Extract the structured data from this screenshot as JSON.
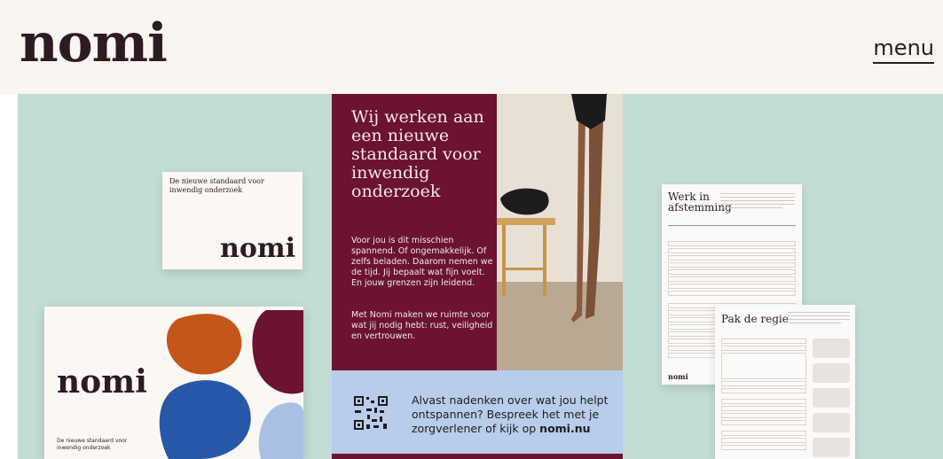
{
  "header": {
    "logo": "nomi",
    "menu_label": "menu"
  },
  "card_small": {
    "subtitle": "De nieuwe standaard voor inwendig onderzoek",
    "brand": "nomi"
  },
  "box": {
    "brand": "nomi",
    "subtitle": "De nieuwe standaard voor inwendig onderzoek"
  },
  "poster": {
    "headline": "Wij werken aan een nieuwe standaard voor inwendig onderzoek",
    "body1": "Voor jou is dit misschien spannend. Of ongemakkelijk. Of zelfs beladen. Daarom nemen we de tijd. Jij bepaalt wat fijn voelt. En jouw grenzen zijn leidend.",
    "body2": "Met Nomi maken we ruimte voor wat jij nodig hebt: rust, veiligheid en vertrouwen.",
    "cta_text": "Alvast nadenken over wat jou helpt ontspannen? Bespreek het met je zorgverlener of kijk op",
    "cta_link": "nomi.nu"
  },
  "sheet1": {
    "title": "Werk in afstemming",
    "brand": "nomi"
  },
  "sheet2": {
    "title": "Pak de regie"
  },
  "colors": {
    "header_bg": "#f9f5f0",
    "hero_bg": "#c3dcd5",
    "brand_dark": "#2e1a22",
    "poster_maroon": "#6b1331",
    "poster_blue": "#b8cdec"
  },
  "icons": [
    "qr-code-icon"
  ]
}
